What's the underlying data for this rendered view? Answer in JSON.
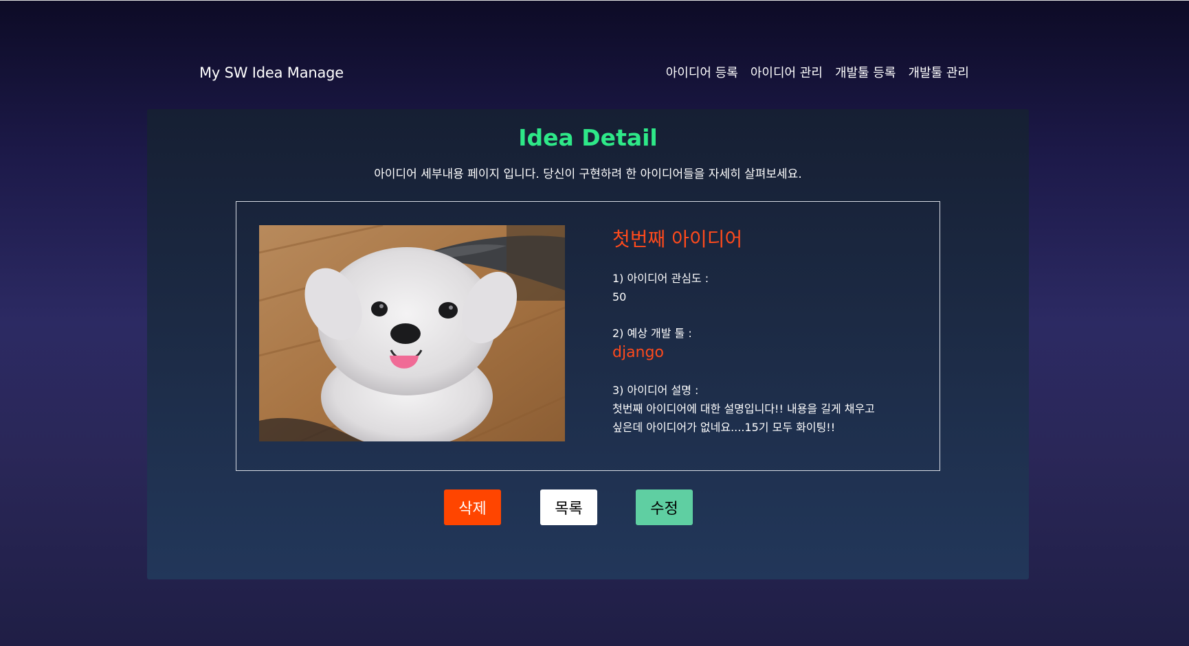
{
  "navbar": {
    "brand": "My SW Idea Manage",
    "links": [
      "아이디어 등록",
      "아이디어 관리",
      "개발툴 등록",
      "개발툴 관리"
    ]
  },
  "main": {
    "title": "Idea Detail",
    "subtitle": "아이디어 세부내용 페이지 입니다. 당신이 구현하려 한 아이디어들을 자세히 살펴보세요.",
    "idea": {
      "name": "첫번째 아이디어",
      "interest_label": "1) 아이디어 관심도 :",
      "interest_value": "50",
      "tool_label": "2) 예상 개발 툴 :",
      "tool_value": "django",
      "desc_label": "3) 아이디어 설명 :",
      "desc_line1": "첫번째 아이디어에 대한 설명입니다!! 내용을 길게 채우고",
      "desc_line2": "싶은데 아이디어가 없네요....15기 모두 화이팅!!"
    },
    "buttons": {
      "delete": "삭제",
      "list": "목록",
      "edit": "수정"
    }
  },
  "colors": {
    "title_green": "#2ee888",
    "accent_red": "#ff4500",
    "edit_green": "#5fcfa2"
  }
}
